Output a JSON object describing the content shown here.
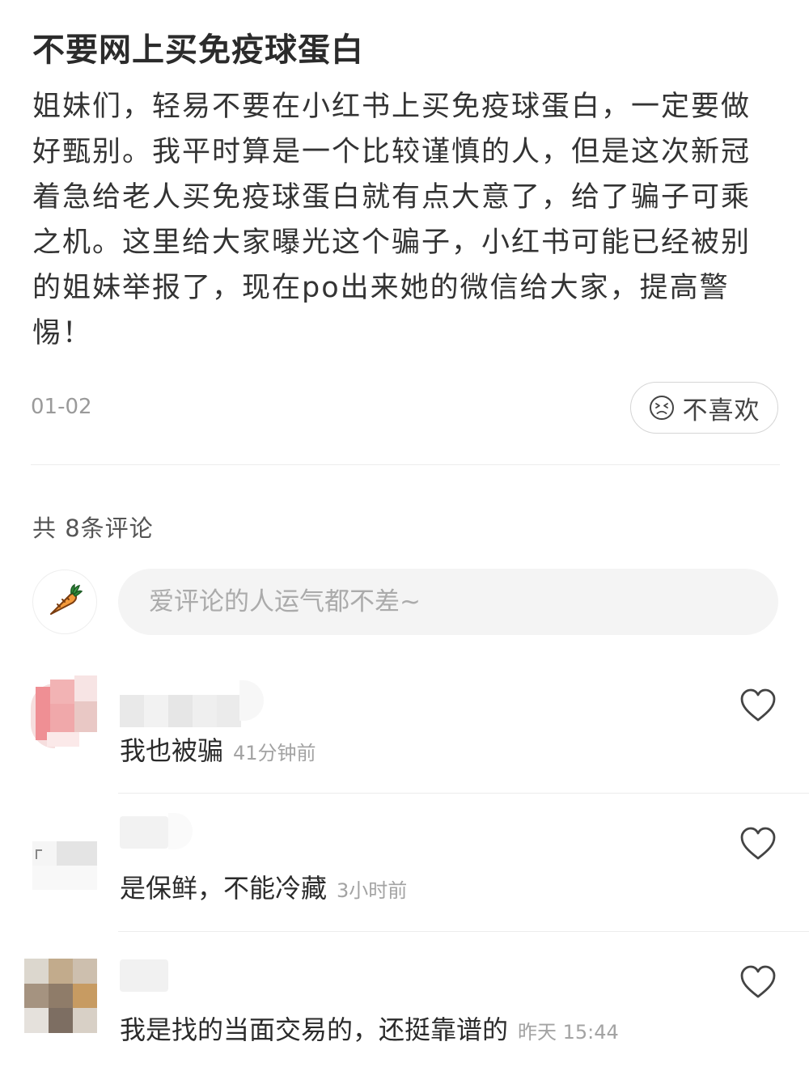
{
  "post": {
    "title": "不要网上买免疫球蛋白",
    "body": "姐妹们，轻易不要在小红书上买免疫球蛋白，一定要做好甄别。我平时算是一个比较谨慎的人，但是这次新冠着急给老人买免疫球蛋白就有点大意了，给了骗子可乘之机。这里给大家曝光这个骗子，小红书可能已经被别的姐妹举报了，现在po出来她的微信给大家，提高警惕！",
    "date": "01-02",
    "dislike_label": "不喜欢",
    "dislike_icon": "frown-face-icon"
  },
  "comments_section": {
    "count_label": "共 8条评论",
    "input_placeholder": "爱评论的人运气都不差~",
    "my_avatar_icon": "carrot-icon"
  },
  "comments": [
    {
      "text": "我也被骗",
      "time": "41分钟前",
      "like_icon": "heart-outline-icon"
    },
    {
      "text": "是保鲜，不能冷藏",
      "time": "3小时前",
      "like_icon": "heart-outline-icon"
    },
    {
      "text": "我是找的当面交易的，还挺靠谱的",
      "time": "昨天 15:44",
      "like_icon": "heart-outline-icon"
    }
  ],
  "colors": {
    "primary_text": "#2b2b2b",
    "secondary_text": "#9a9a9a",
    "input_bg": "#f4f4f4"
  }
}
